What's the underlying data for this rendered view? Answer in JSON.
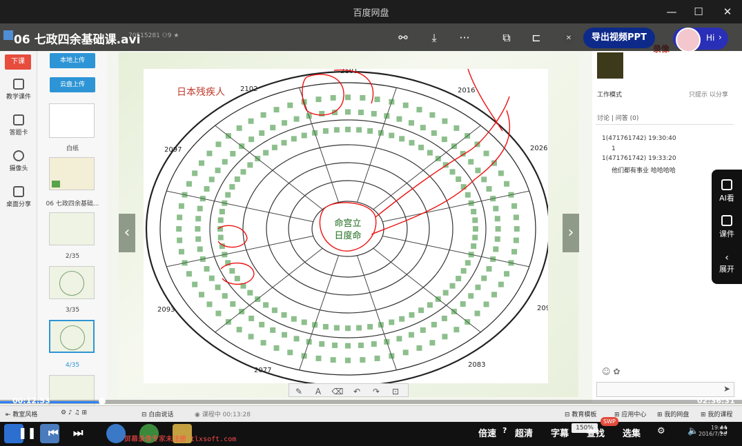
{
  "window": {
    "title": "百度网盘"
  },
  "file": {
    "name": "06 七政四余基础课.avi",
    "meta": "70515281",
    "views": "9"
  },
  "toolbar": {
    "export_label": "导出视频PPT",
    "hi_label": "Hi"
  },
  "lefttools": {
    "end_class": "下课",
    "items": [
      {
        "label": "教学课件"
      },
      {
        "label": "答题卡"
      },
      {
        "label": "摄像头"
      },
      {
        "label": "桌面分享"
      }
    ]
  },
  "thumbs": {
    "upload_local": "本地上传",
    "upload_cloud": "云盘上传",
    "items": [
      {
        "label": "白纸"
      },
      {
        "label": "06 七政四余基础..."
      },
      {
        "label": "2/35"
      },
      {
        "label": "3/35"
      },
      {
        "label": "4/35"
      }
    ]
  },
  "slide": {
    "heading": "日本残疾人",
    "rim_years": [
      "2101",
      "2102",
      "2016",
      "2097",
      "2026",
      "2093",
      "2098",
      "2077",
      "2083"
    ],
    "center_lines": [
      "命宫立",
      "日度命"
    ]
  },
  "rightpanel": {
    "rec_label": "录像",
    "mode": "工作模式",
    "mode_right": "只提示 以分享",
    "tabs": "讨论 | 问答 (0)",
    "messages": [
      {
        "user": "1(471761742) 19:30:40",
        "text": "1"
      },
      {
        "user": "1(471761742) 19:33:20",
        "text": "他们都有事业 哈哈哈哈"
      }
    ]
  },
  "sidefloat": {
    "ai": "AI看",
    "courseware": "课件",
    "expand": "展开"
  },
  "player": {
    "time_current": "00:12:53",
    "time_total": "02:36:31",
    "progress": 0.1375,
    "speed": "倍速",
    "quality": "超清",
    "subtitle": "字幕",
    "find": "查找",
    "episodes": "选集",
    "speed_badge": "150%",
    "swp": "SWP",
    "watermark": "屏幕录像专家未注册 tlxsoft.com",
    "clock_time": "19:44",
    "clock_date": "2016/7/26"
  },
  "bottombar": {
    "left": [
      "教室风格",
      "白由说话",
      "课程中 00:13:28"
    ],
    "right": [
      "教育模板",
      "应用中心",
      "我的网盘",
      "我的课程"
    ]
  }
}
